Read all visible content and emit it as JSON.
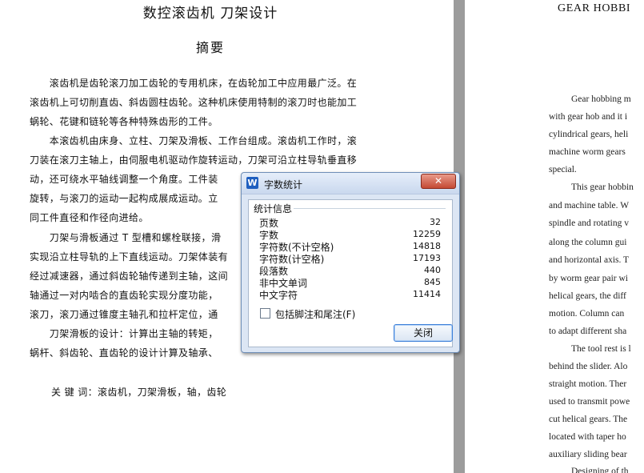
{
  "left_page": {
    "title": "数控滚齿机  刀架设计",
    "abstract_title": "摘要",
    "lines": [
      "　　滚齿机是齿轮滚刀加工齿轮的专用机床，在齿轮加工中应用最广泛。在",
      "滚齿机上可切削直齿、斜齿圆柱齿轮。这种机床使用特制的滚刀时也能加工",
      "蜗轮、花键和链轮等各种特殊齿形的工件。",
      "　　本滚齿机由床身、立柱、刀架及滑板、工作台组成。滚齿机工作时，滚",
      "刀装在滚刀主轴上，由伺服电机驱动作旋转运动，刀架可沿立柱导轨垂直移",
      "动，还可绕水平轴线调整一个角度。工件装",
      "旋转，与滚刀的运动一起构成展成运动。立",
      "同工件直径和作径向进给。",
      "　　刀架与滑板通过 T 型槽和螺栓联接，滑",
      "实现沿立柱导轨的上下直线运动。刀架体装有",
      "经过减速器，通过斜齿轮轴传递到主轴，这间",
      "轴通过一对内啮合的直齿轮实现分度功能，",
      "滚刀，滚刀通过锥度主轴孔和拉杆定位，通",
      "　　刀架滑板的设计：计算出主轴的转矩，",
      "蜗杆、斜齿轮、直齿轮的设计计算及轴承、"
    ],
    "keywords": "关 键 词：滚齿机，刀架滑板，轴，齿轮"
  },
  "right_page": {
    "title": "GEAR HOBBI",
    "lines": [
      "Gear hobbing m",
      "with gear hob and it i",
      "cylindrical gears, heli",
      "machine worm gears",
      "special.",
      "This gear hobbin",
      "and machine table. W",
      "spindle and rotating v",
      "along the column gui",
      "and horizontal axis. T",
      "by worm gear pair wi",
      "helical gears, the diff",
      "motion. Column can",
      "to adapt different sha",
      "The tool rest is l",
      "behind the slider. Alo",
      "straight motion. Ther",
      "used to transmit powe",
      "cut helical gears. The",
      "located with taper ho",
      "auxiliary sliding bear",
      "Designing of th"
    ]
  },
  "dialog": {
    "title": "字数统计",
    "close_x": "✕",
    "group_label": "统计信息",
    "stats": [
      {
        "label": "页数",
        "value": "32"
      },
      {
        "label": "字数",
        "value": "12259"
      },
      {
        "label": "字符数(不计空格)",
        "value": "14818"
      },
      {
        "label": "字符数(计空格)",
        "value": "17193"
      },
      {
        "label": "段落数",
        "value": "440"
      },
      {
        "label": "非中文单词",
        "value": "845"
      },
      {
        "label": "中文字符",
        "value": "11414"
      }
    ],
    "footnote_label": "包括脚注和尾注(F)",
    "close_button": "关闭"
  }
}
